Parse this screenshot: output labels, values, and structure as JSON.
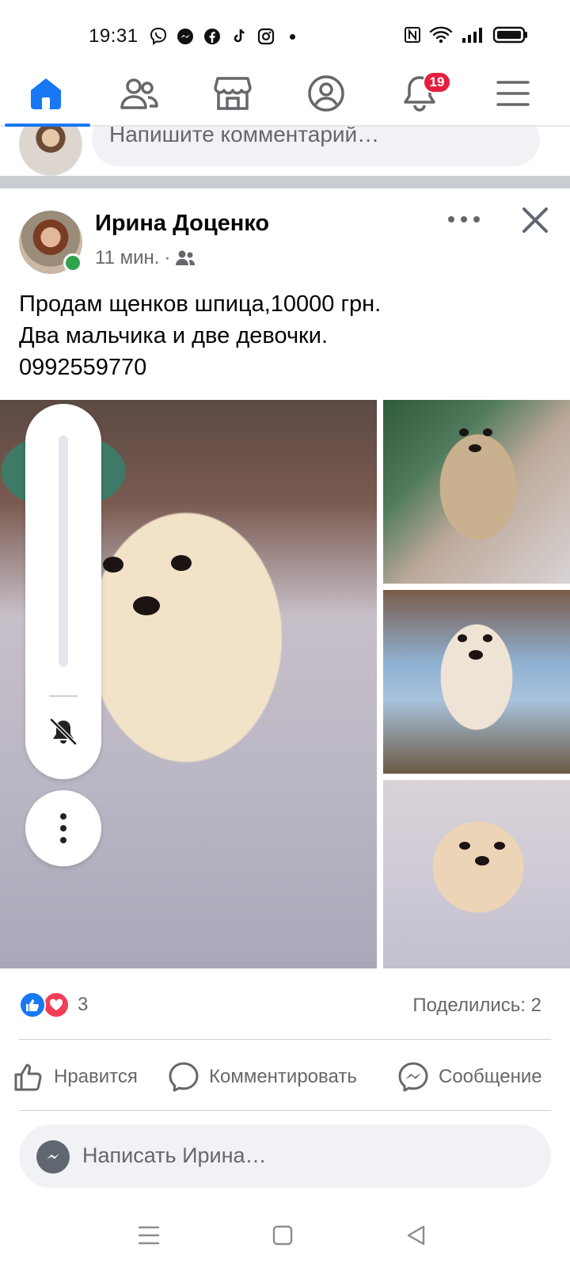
{
  "status_bar": {
    "time": "19:31",
    "app_icons": [
      "viber-icon",
      "messenger-icon",
      "facebook-icon",
      "tiktok-icon",
      "instagram-icon"
    ],
    "system_icons": [
      "nfc-icon",
      "wifi-icon",
      "signal-icon",
      "battery-icon"
    ]
  },
  "nav": {
    "items": [
      "home",
      "friends",
      "marketplace",
      "profile",
      "notifications",
      "menu"
    ],
    "active": "home",
    "notifications_badge": "19",
    "accent": "#1877f2",
    "badge_color": "#e41e3f"
  },
  "prev_comment": {
    "placeholder": "Напишите комментарий…"
  },
  "post": {
    "author": "Ирина Доценко",
    "time": "11 мин.",
    "audience_icon": "friends-icon",
    "text_lines": [
      "Продам щенков шпица,10000 грн.",
      "Два мальчика и две девочки.",
      "0992559770"
    ],
    "photo_count": 4
  },
  "reactions": {
    "types": [
      "like",
      "love"
    ],
    "count": "3",
    "shares": "Поделились: 2"
  },
  "actions": {
    "like": "Нравится",
    "comment": "Комментировать",
    "message": "Сообщение"
  },
  "message_box": {
    "placeholder": "Написать Ирина…"
  },
  "volume": {
    "muted": true,
    "level": 0
  }
}
